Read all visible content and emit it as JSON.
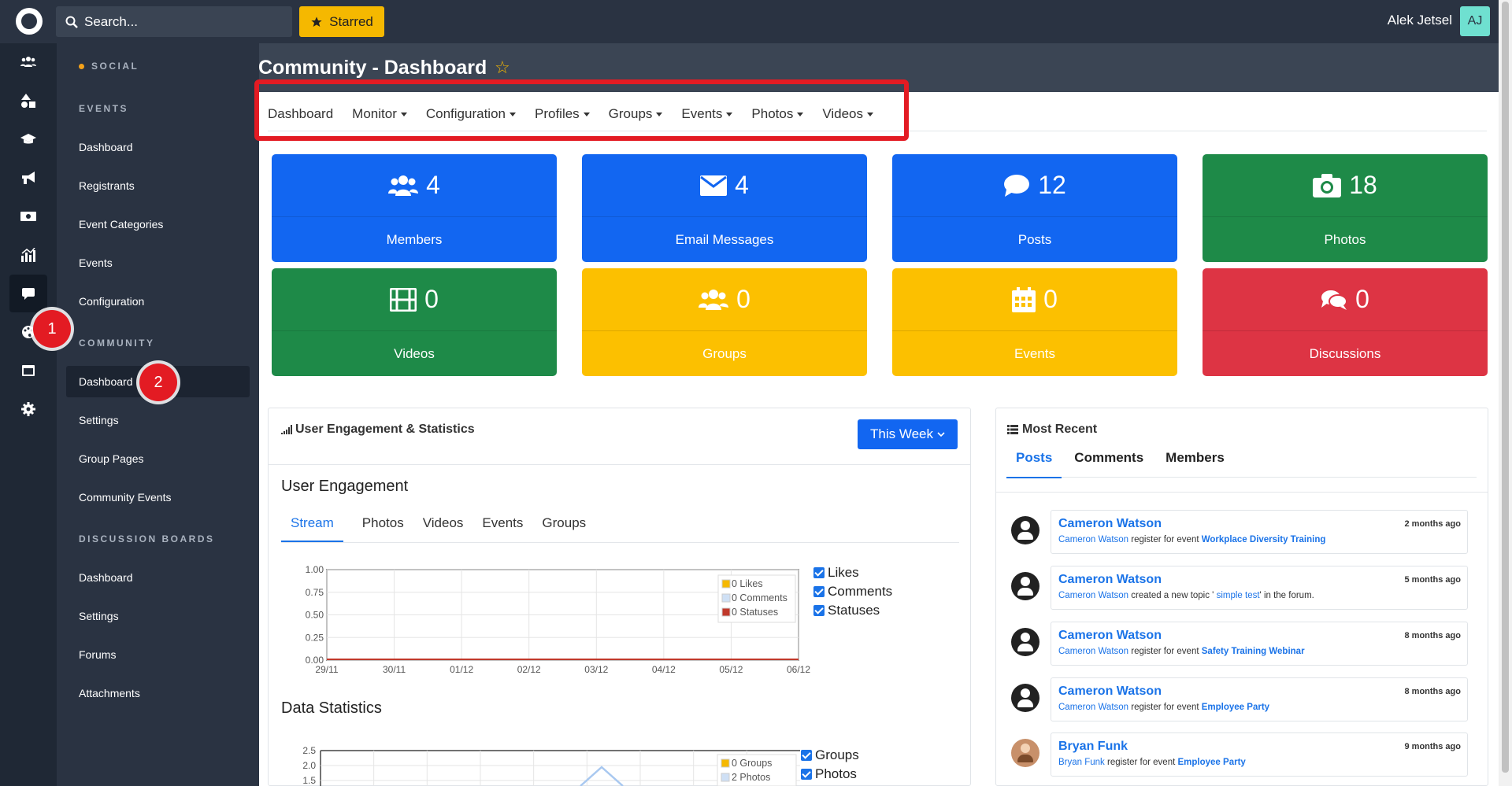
{
  "topbar": {
    "search_placeholder": "Search...",
    "starred_label": "Starred",
    "user_name": "Alek Jetsel",
    "user_initials": "AJ"
  },
  "rail_icons": [
    "users-icon",
    "shapes-icon",
    "graduation-cap-icon",
    "megaphone-icon",
    "money-icon",
    "chart-icon",
    "chat-icon",
    "palette-icon",
    "calendar-icon",
    "gear-icon"
  ],
  "sidebar": {
    "social_label": "SOCIAL",
    "events_label": "EVENTS",
    "events_items": [
      "Dashboard",
      "Registrants",
      "Event Categories",
      "Events",
      "Configuration"
    ],
    "community_label": "COMMUNITY",
    "community_items": [
      "Dashboard",
      "Settings",
      "Group Pages",
      "Community Events"
    ],
    "discussion_label": "DISCUSSION BOARDS",
    "discussion_items": [
      "Dashboard",
      "Settings",
      "Forums",
      "Attachments"
    ]
  },
  "markers": [
    "1",
    "2"
  ],
  "page": {
    "title": "Community - Dashboard"
  },
  "module_tabs": [
    "Dashboard",
    "Monitor",
    "Configuration",
    "Profiles",
    "Groups",
    "Events",
    "Photos",
    "Videos"
  ],
  "cards": [
    {
      "value": "4",
      "label": "Members",
      "icon": "users-icon",
      "color": "#1266f1"
    },
    {
      "value": "4",
      "label": "Email Messages",
      "icon": "envelope-icon",
      "color": "#1266f1"
    },
    {
      "value": "12",
      "label": "Posts",
      "icon": "comment-icon",
      "color": "#1266f1"
    },
    {
      "value": "18",
      "label": "Photos",
      "icon": "camera-icon",
      "color": "#1e8a48"
    },
    {
      "value": "0",
      "label": "Videos",
      "icon": "film-icon",
      "color": "#1e8a48"
    },
    {
      "value": "0",
      "label": "Groups",
      "icon": "users-icon",
      "color": "#fcc000"
    },
    {
      "value": "0",
      "label": "Events",
      "icon": "calendar-icon",
      "color": "#fcc000"
    },
    {
      "value": "0",
      "label": "Discussions",
      "icon": "comments-icon",
      "color": "#dd3444"
    }
  ],
  "engagement": {
    "panel_title": "User Engagement & Statistics",
    "range_button": "This Week",
    "section_title": "User Engagement",
    "tabs": [
      "Stream",
      "Photos",
      "Videos",
      "Events",
      "Groups"
    ],
    "checks": [
      "Likes",
      "Comments",
      "Statuses"
    ],
    "legend": [
      "0 Likes",
      "0 Comments",
      "0 Statuses"
    ],
    "data_stats_title": "Data Statistics",
    "data_checks": [
      "Groups",
      "Photos"
    ],
    "data_legend": [
      "0 Groups",
      "2 Photos"
    ]
  },
  "recent": {
    "title": "Most Recent",
    "tabs": [
      "Posts",
      "Comments",
      "Members"
    ],
    "items": [
      {
        "name": "Cameron Watson",
        "time": "2 months ago",
        "actor": "Cameron Watson",
        "text": " register for event ",
        "target": "Workplace Diversity Training",
        "target_bold": true
      },
      {
        "name": "Cameron Watson",
        "time": "5 months ago",
        "actor": "Cameron Watson",
        "text": " created a new topic ' ",
        "target": "simple test",
        "target_bold": false,
        "tail": "' in the forum."
      },
      {
        "name": "Cameron Watson",
        "time": "8 months ago",
        "actor": "Cameron Watson",
        "text": " register for event ",
        "target": "Safety Training Webinar",
        "target_bold": true
      },
      {
        "name": "Cameron Watson",
        "time": "8 months ago",
        "actor": "Cameron Watson",
        "text": " register for event ",
        "target": "Employee Party",
        "target_bold": true
      },
      {
        "name": "Bryan Funk",
        "time": "9 months ago",
        "actor": "Bryan Funk",
        "text": " register for event ",
        "target": "Employee Party",
        "target_bold": true
      }
    ]
  },
  "chart_data": [
    {
      "type": "line",
      "title": "User Engagement",
      "x": [
        "29/11",
        "30/11",
        "01/12",
        "02/12",
        "03/12",
        "04/12",
        "05/12",
        "06/12"
      ],
      "ylim": [
        0,
        1
      ],
      "yticks": [
        "1.00",
        "0.75",
        "0.50",
        "0.25",
        "0.00"
      ],
      "series": [
        {
          "name": "Likes",
          "values": [
            0,
            0,
            0,
            0,
            0,
            0,
            0,
            0
          ],
          "color": "#f5b800"
        },
        {
          "name": "Comments",
          "values": [
            0,
            0,
            0,
            0,
            0,
            0,
            0,
            0
          ],
          "color": "#a8c8f0"
        },
        {
          "name": "Statuses",
          "values": [
            0,
            0,
            0,
            0,
            0,
            0,
            0,
            0
          ],
          "color": "#c0392b"
        }
      ],
      "grid": true,
      "legend": "top-right"
    },
    {
      "type": "line",
      "title": "Data Statistics",
      "yticks": [
        "2.5",
        "2.0",
        "1.5"
      ],
      "series": [
        {
          "name": "Groups",
          "color": "#f5b800"
        },
        {
          "name": "Photos",
          "color": "#a8c8f0"
        }
      ],
      "grid": true,
      "legend": "top-right"
    }
  ]
}
